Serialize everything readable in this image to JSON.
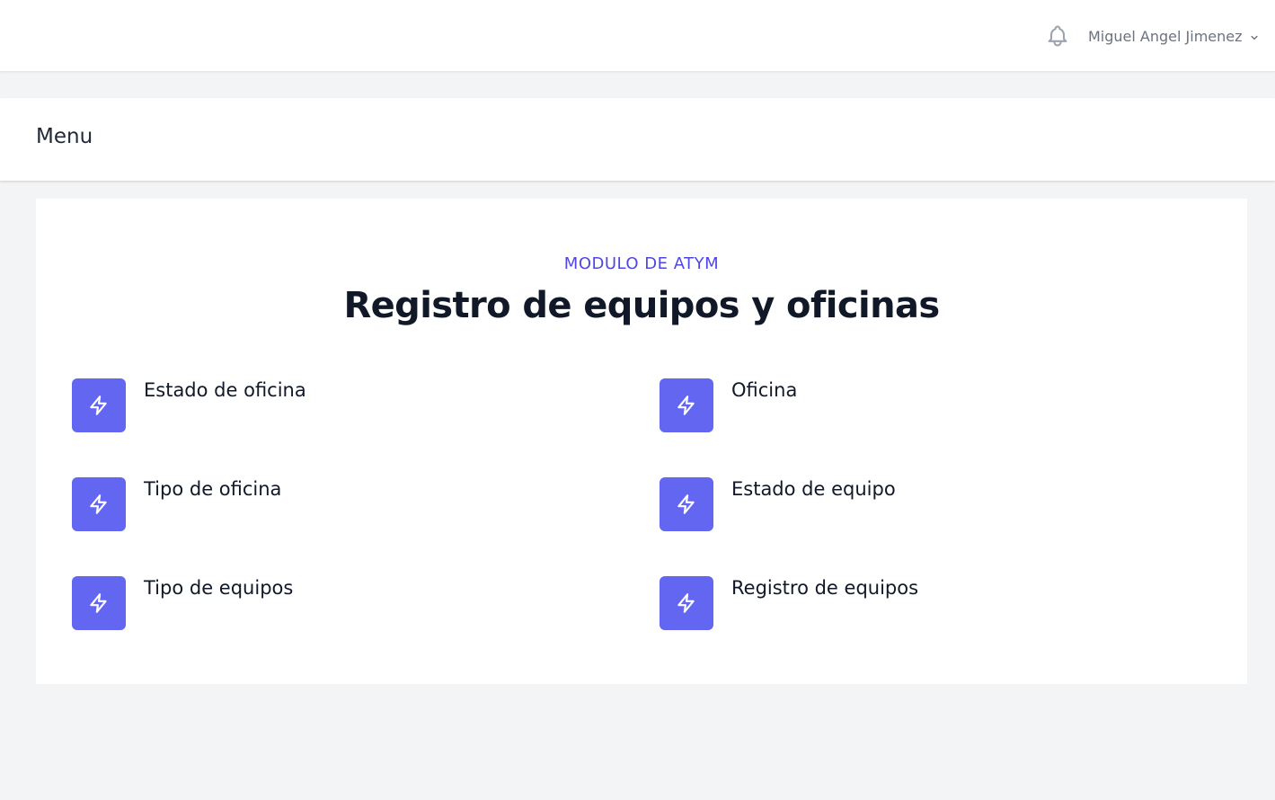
{
  "topbar": {
    "user_name": "Miguel Angel Jimenez",
    "icons": {
      "notifications": "bell-icon",
      "user_menu": "chevron-down-icon"
    }
  },
  "menu": {
    "title": "Menu"
  },
  "hero": {
    "eyebrow": "MODULO DE ATYM",
    "title": "Registro de equipos y oficinas"
  },
  "features": [
    {
      "label": "Estado de oficina",
      "icon": "lightning-bolt-icon"
    },
    {
      "label": "Oficina",
      "icon": "lightning-bolt-icon"
    },
    {
      "label": "Tipo de oficina",
      "icon": "lightning-bolt-icon"
    },
    {
      "label": "Estado de equipo",
      "icon": "lightning-bolt-icon"
    },
    {
      "label": "Tipo de equipos",
      "icon": "lightning-bolt-icon"
    },
    {
      "label": "Registro de equipos",
      "icon": "lightning-bolt-icon"
    }
  ],
  "colors": {
    "accent": "#6366f1",
    "eyebrow": "#4f46e5",
    "background": "#f3f4f6"
  }
}
